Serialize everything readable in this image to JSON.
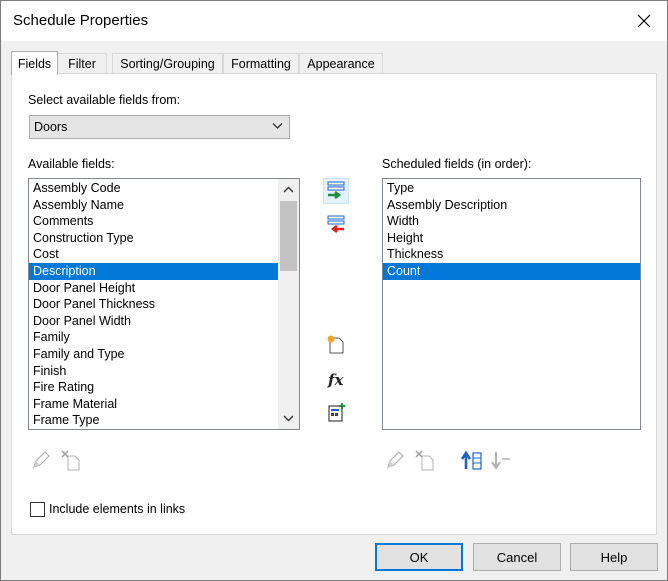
{
  "window": {
    "title": "Schedule Properties"
  },
  "tabs": [
    {
      "label": "Fields"
    },
    {
      "label": "Filter"
    },
    {
      "label": "Sorting/Grouping"
    },
    {
      "label": "Formatting"
    },
    {
      "label": "Appearance"
    }
  ],
  "fields_tab": {
    "select_from_label": "Select available fields from:",
    "select_from_value": "Doors",
    "available_label": "Available fields:",
    "available_items": [
      "Assembly Code",
      "Assembly Name",
      "Comments",
      "Construction Type",
      "Cost",
      "Description",
      "Door Panel Height",
      "Door Panel Thickness",
      "Door Panel Width",
      "Family",
      "Family and Type",
      "Finish",
      "Fire Rating",
      "Frame Material",
      "Frame Type"
    ],
    "available_selected": "Description",
    "scheduled_label": "Scheduled fields (in order):",
    "scheduled_items": [
      "Type",
      "Assembly Description",
      "Width",
      "Height",
      "Thickness",
      "Count"
    ],
    "scheduled_selected": "Count",
    "include_links_label": "Include elements in links",
    "include_links_checked": false
  },
  "buttons": {
    "ok": "OK",
    "cancel": "Cancel",
    "help": "Help"
  },
  "colors": {
    "selection": "#0078d7",
    "add_arrow": "#1f8f3a",
    "remove_arrow": "#e02020",
    "move_blue": "#1e63c8"
  },
  "icons": {
    "add": "add-parameter-icon",
    "remove": "remove-parameter-icon",
    "new_parameter": "new-parameter-icon",
    "calculated": "calculated-value-icon",
    "combine": "combine-parameters-icon",
    "edit": "edit-pencil-icon",
    "delete": "delete-parameter-icon",
    "move_up": "move-up-icon",
    "move_down": "move-down-icon"
  }
}
